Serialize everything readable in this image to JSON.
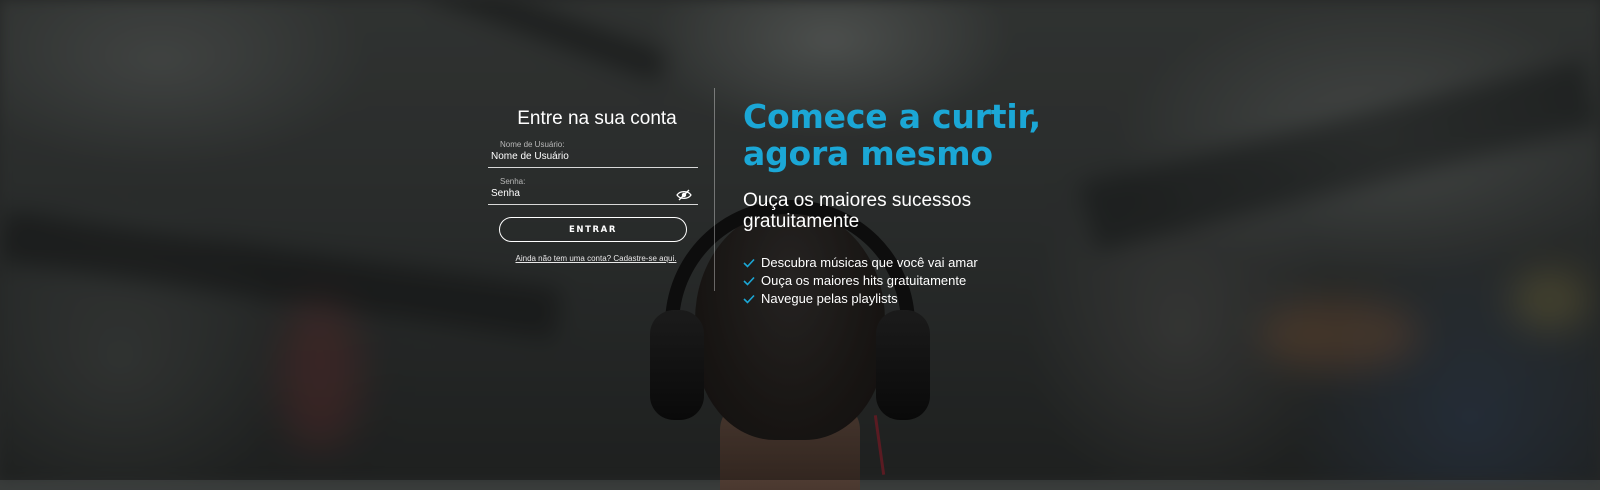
{
  "login": {
    "title": "Entre na sua conta",
    "username": {
      "label": "Nome de Usuário:",
      "placeholder": "Nome de Usuário"
    },
    "password": {
      "label": "Senha:",
      "placeholder": "Senha"
    },
    "toggle_icon": "eye-slash-icon",
    "submit_label": "ENTRAR",
    "signup_link": "Ainda não tem uma conta? Cadastre-se aqui."
  },
  "promo": {
    "headline_line1": "Comece a curtir,",
    "headline_line2": "agora mesmo",
    "subhead_line1": "Ouça os maiores sucessos",
    "subhead_line2": "gratuitamente",
    "features": [
      "Descubra músicas que você vai amar",
      "Ouça os maiores hits gratuitamente",
      "Navegue pelas playlists"
    ],
    "feature_icon": "check-icon"
  },
  "colors": {
    "accent": "#1ba7d6",
    "text": "#ffffff",
    "overlay": "rgba(0,0,0,0.35)"
  }
}
